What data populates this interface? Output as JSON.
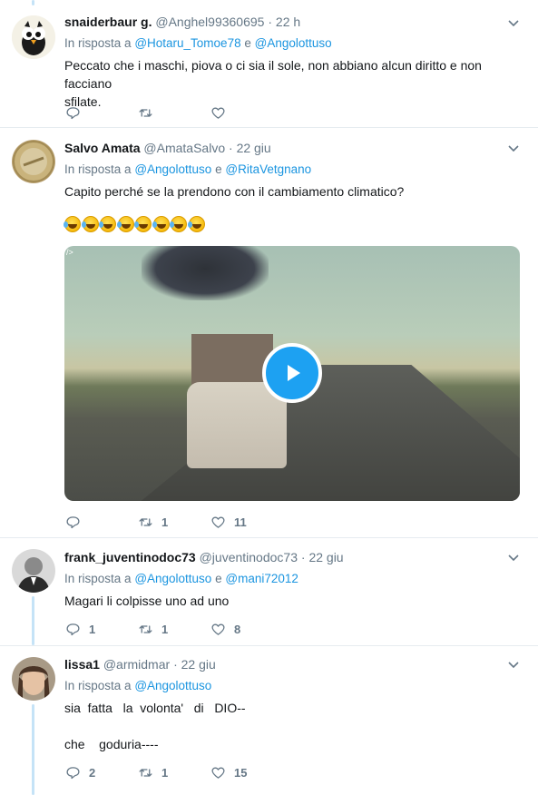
{
  "colors": {
    "accent": "#1b95e0",
    "play": "#1da1f2",
    "muted": "#657786",
    "thread": "#c5e3f7"
  },
  "tweets": [
    {
      "name": "snaiderbaur g.",
      "handle": "@Anghel99360695",
      "dot": "·",
      "time": "22 h",
      "reply_prefix": "In risposta a",
      "mention1": "@Hotaru_Tomoe78",
      "and": "e",
      "mention2": "@Angolottuso",
      "text": "Peccato che i maschi, piova o ci sia il sole, non abbiano alcun diritto e non facciano\nsfilate.",
      "reply_count": "",
      "retweet_count": "",
      "like_count": ""
    },
    {
      "name": "Salvo Amata",
      "handle": "@AmataSalvo",
      "dot": "·",
      "time": "22 giu",
      "reply_prefix": "In risposta a",
      "mention1": "@Angolottuso",
      "and": "e",
      "mention2": "@RitaVetgnano",
      "text": "Capito perché se la prendono con il cambiamento climatico?",
      "emoji": "🤣🤣🤣🤣🤣🤣🤣🤣",
      "video_tag": "/>",
      "reply_count": "",
      "retweet_count": "1",
      "like_count": "11"
    },
    {
      "name": "frank_juventinodoc73",
      "handle": "@juventinodoc73",
      "dot": "·",
      "time": "22 giu",
      "reply_prefix": "In risposta a",
      "mention1": "@Angolottuso",
      "and": "e",
      "mention2": "@mani72012",
      "text": "Magari li colpisse uno ad uno",
      "reply_count": "1",
      "retweet_count": "1",
      "like_count": "8"
    },
    {
      "name": "lissa1",
      "handle": "@armidmar",
      "dot": "·",
      "time": "22 giu",
      "reply_prefix": "In risposta a",
      "mention1": "@Angolottuso",
      "text": "sia  fatta   la  volonta'   di   DIO--\n\nche    goduria----",
      "reply_count": "2",
      "retweet_count": "1",
      "like_count": "15"
    }
  ]
}
